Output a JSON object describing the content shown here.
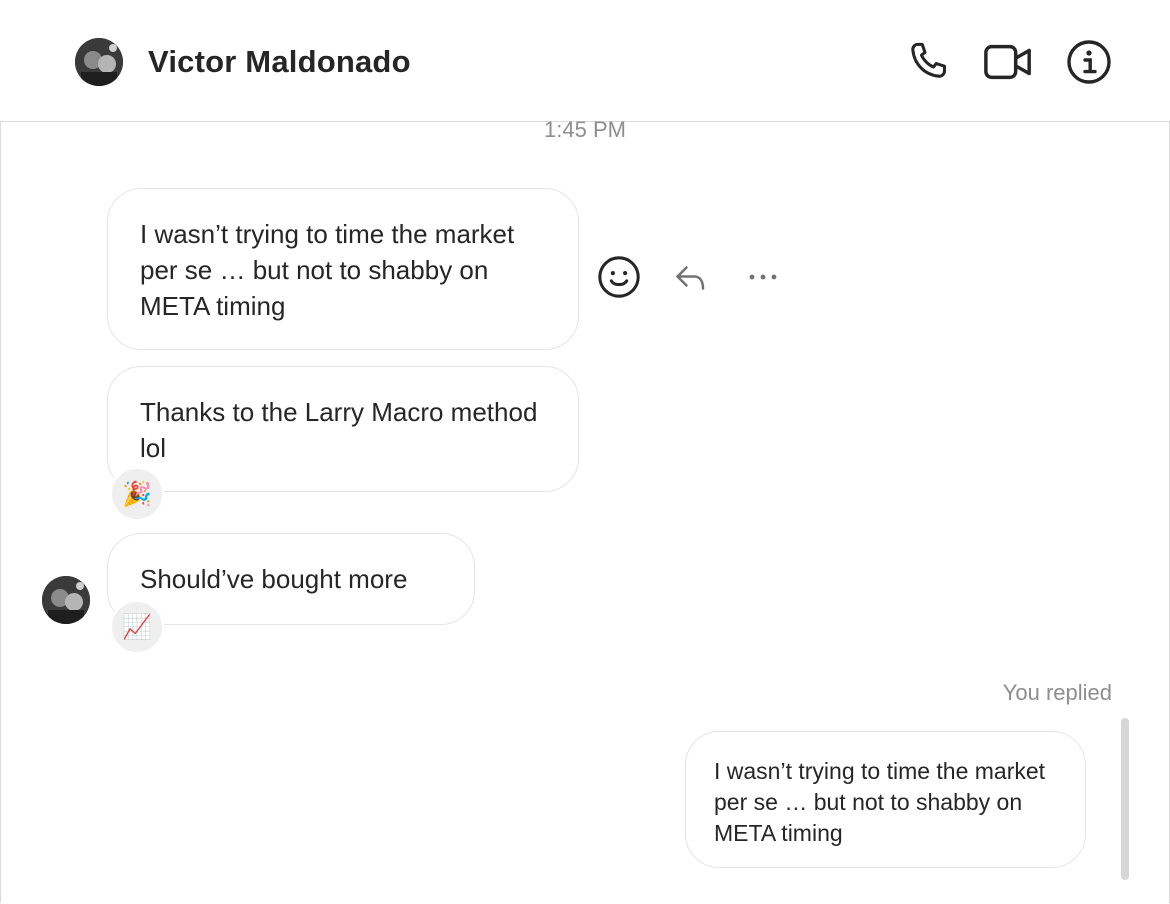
{
  "header": {
    "contact_name": "Victor Maldonado",
    "icons": [
      "phone-icon",
      "video-camera-icon",
      "info-icon"
    ]
  },
  "thread": {
    "timestamp": "1:45 PM",
    "messages": [
      {
        "text": "I wasn’t trying to time the market per se … but not to shabby on META timing"
      },
      {
        "text": "Thanks to the Larry Macro method lol",
        "reaction": "🎉"
      },
      {
        "text": "Should’ve bought more",
        "reaction": "📈"
      }
    ],
    "reply_label": "You replied",
    "reply_text": "I wasn’t trying to time the market per se … but not to shabby on META timing"
  },
  "colors": {
    "text": "#262626",
    "muted": "#8e8e8e",
    "border": "#dbdbdb",
    "reaction_bg": "#efefef"
  }
}
